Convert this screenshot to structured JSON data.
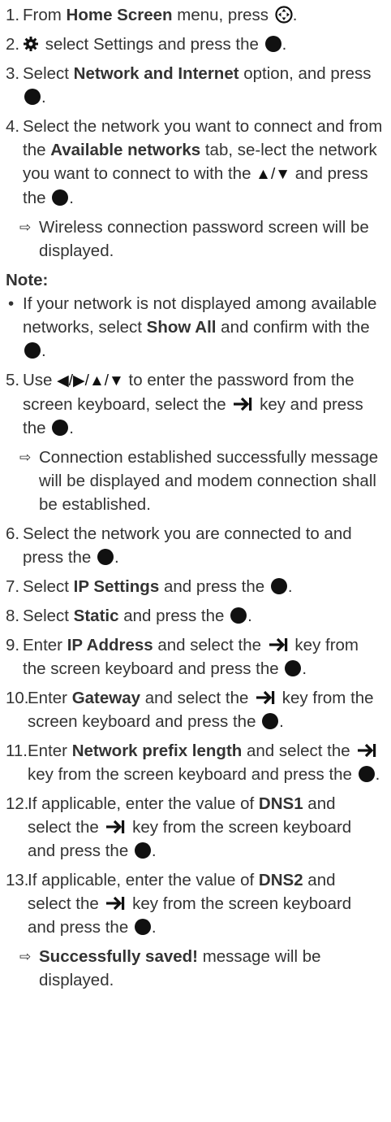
{
  "steps": [
    {
      "num": "1.",
      "a": "From ",
      "b": "Home Screen",
      "c": " menu, press "
    },
    {
      "num": "2.",
      "a": " select Settings and press the "
    },
    {
      "num": "3.",
      "a": "Select ",
      "b": "Network and Internet",
      "c": " option, and press "
    },
    {
      "num": "4.",
      "a": "Select the network you want to connect and from the ",
      "b": "Available networks",
      "c": " tab, se-lect the network you want to connect to with the ",
      "sym": "▲/▼",
      "d": " and press the "
    },
    {
      "num": "5.",
      "a": "Use ",
      "sym": "◀/▶/▲/▼",
      "b": " to enter the password from the screen keyboard, select the ",
      "c": " key and press the "
    },
    {
      "num": "6.",
      "a": "Select the network you are connected to and press the "
    },
    {
      "num": "7.",
      "a": "Select ",
      "b": "IP Settings",
      "c": " and press the "
    },
    {
      "num": "8.",
      "a": "Select ",
      "b": "Static",
      "c": " and press the "
    },
    {
      "num": "9.",
      "a": "Enter ",
      "b": "IP Address",
      "c": " and select the ",
      "d": " key from the screen keyboard and press the "
    },
    {
      "num": "10.",
      "a": "Enter ",
      "b": "Gateway",
      "c": " and select the ",
      "d": " key from the screen keyboard and press the "
    },
    {
      "num": "11.",
      "a": "Enter ",
      "b": "Network prefix length",
      "c": " and select the ",
      "d": " key from the screen keyboard and press the "
    },
    {
      "num": "12.",
      "a": "If applicable, enter the value of ",
      "b": "DNS1",
      "c": " and select the ",
      "d": " key from the screen keyboard and press the "
    },
    {
      "num": "13.",
      "a": "If applicable, enter the value of ",
      "b": "DNS2",
      "c": " and select the ",
      "d": " key from the screen keyboard and press the "
    }
  ],
  "results": {
    "r1": "Wireless connection password screen will be displayed.",
    "r2": "Connection established successfully message will be displayed and modem connection shall be established.",
    "r3_bold": "Successfully saved!",
    "r3_rest": " message will be displayed."
  },
  "note": {
    "title": "Note:",
    "a": "If your network is not displayed among available networks, select ",
    "b": "Show All",
    "c": " and confirm with the "
  },
  "glyphs": {
    "arrow": "⇨",
    "bullet": "•",
    "period": "."
  },
  "icons": {
    "ok": "ok-button-icon",
    "nav": "navigation-pad-icon",
    "settings": "gear-icon",
    "tab": "tab-key-icon"
  }
}
